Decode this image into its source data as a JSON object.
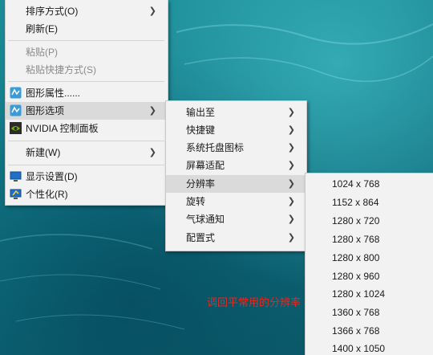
{
  "main_menu": {
    "sort_by": "排序方式(O)",
    "refresh": "刷新(E)",
    "paste": "粘贴(P)",
    "paste_shortcut": "粘贴快捷方式(S)",
    "graphics_properties": "图形属性......",
    "graphics_options": "图形选项",
    "nvidia_panel": "NVIDIA 控制面板",
    "new": "新建(W)",
    "display_settings": "显示设置(D)",
    "personalize": "个性化(R)"
  },
  "graphics_submenu": {
    "output_to": "输出至",
    "hotkeys": "快捷键",
    "tray_icon": "系统托盘图标",
    "panel_fit": "屏幕适配",
    "resolution": "分辨率",
    "rotation": "旋转",
    "balloon_notify": "气球通知",
    "profiles": "配置式"
  },
  "resolution_submenu": {
    "items": [
      "1024 x 768",
      "1152 x 864",
      "1280 x 720",
      "1280 x 768",
      "1280 x 800",
      "1280 x 960",
      "1280 x 1024",
      "1360 x 768",
      "1366 x 768",
      "1400 x 1050"
    ]
  },
  "annotation": "调回平常用的分辨率",
  "colors": {
    "menu_bg": "#f2f2f2",
    "highlight": "#dadada",
    "annotation": "#e02b20",
    "desktop": "#127a88"
  },
  "icons": {
    "graphics_properties": "intel-graphics-icon",
    "graphics_options": "intel-graphics-icon",
    "nvidia_panel": "nvidia-icon",
    "display_settings": "monitor-icon",
    "personalize": "personalize-icon",
    "submenu_arrow": "chevron-right-icon"
  }
}
